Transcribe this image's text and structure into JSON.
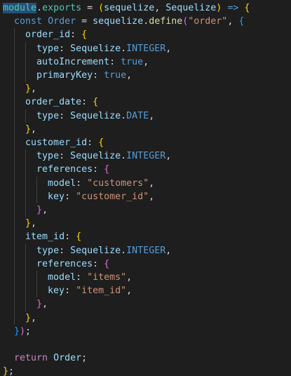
{
  "editor": {
    "theme": {
      "background": "#1e1e1e",
      "default_text": "#d4d4d4",
      "keyword": "#569cd6",
      "control": "#c586c0",
      "variable": "#9cdcfe",
      "type": "#4ec9b0",
      "function": "#dcdcaa",
      "string": "#ce9178",
      "bracket_1": "#ffd700",
      "bracket_2": "#da70d6",
      "bracket_3": "#179fff",
      "indent_guide": "#404040",
      "selection_highlight": "#264f78"
    },
    "lines": [
      {
        "tokens": [
          {
            "t": "module",
            "c": "type",
            "sel": true
          },
          {
            "t": ".",
            "c": "default_text"
          },
          {
            "t": "exports",
            "c": "type"
          },
          {
            "t": " = ",
            "c": "default_text"
          },
          {
            "t": "(",
            "c": "bracket_1"
          },
          {
            "t": "sequelize",
            "c": "variable"
          },
          {
            "t": ", ",
            "c": "default_text"
          },
          {
            "t": "Sequelize",
            "c": "variable"
          },
          {
            "t": ")",
            "c": "bracket_1"
          },
          {
            "t": " ",
            "c": "default_text"
          },
          {
            "t": "=>",
            "c": "keyword"
          },
          {
            "t": " ",
            "c": "default_text"
          },
          {
            "t": "{",
            "c": "bracket_1"
          }
        ]
      },
      {
        "tokens": [
          {
            "t": "  ",
            "c": "default_text"
          },
          {
            "t": "const",
            "c": "keyword"
          },
          {
            "t": " ",
            "c": "default_text"
          },
          {
            "t": "Order",
            "c": "keyword"
          },
          {
            "t": " = ",
            "c": "default_text"
          },
          {
            "t": "sequelize",
            "c": "variable"
          },
          {
            "t": ".",
            "c": "default_text"
          },
          {
            "t": "define",
            "c": "function"
          },
          {
            "t": "(",
            "c": "bracket_2"
          },
          {
            "t": "\"order\"",
            "c": "string"
          },
          {
            "t": ", ",
            "c": "default_text"
          },
          {
            "t": "{",
            "c": "bracket_3"
          }
        ]
      },
      {
        "tokens": [
          {
            "t": "    ",
            "c": "default_text"
          },
          {
            "t": "order_id",
            "c": "variable"
          },
          {
            "t": ": ",
            "c": "default_text"
          },
          {
            "t": "{",
            "c": "bracket_1"
          }
        ]
      },
      {
        "tokens": [
          {
            "t": "      ",
            "c": "default_text"
          },
          {
            "t": "type",
            "c": "variable"
          },
          {
            "t": ": ",
            "c": "default_text"
          },
          {
            "t": "Sequelize",
            "c": "variable"
          },
          {
            "t": ".",
            "c": "default_text"
          },
          {
            "t": "INTEGER",
            "c": "keyword"
          },
          {
            "t": ",",
            "c": "default_text"
          }
        ]
      },
      {
        "tokens": [
          {
            "t": "      ",
            "c": "default_text"
          },
          {
            "t": "autoIncrement",
            "c": "variable"
          },
          {
            "t": ": ",
            "c": "default_text"
          },
          {
            "t": "true",
            "c": "keyword"
          },
          {
            "t": ",",
            "c": "default_text"
          }
        ]
      },
      {
        "tokens": [
          {
            "t": "      ",
            "c": "default_text"
          },
          {
            "t": "primaryKey",
            "c": "variable"
          },
          {
            "t": ": ",
            "c": "default_text"
          },
          {
            "t": "true",
            "c": "keyword"
          },
          {
            "t": ",",
            "c": "default_text"
          }
        ]
      },
      {
        "tokens": [
          {
            "t": "    ",
            "c": "default_text"
          },
          {
            "t": "}",
            "c": "bracket_1"
          },
          {
            "t": ",",
            "c": "default_text"
          }
        ]
      },
      {
        "tokens": [
          {
            "t": "    ",
            "c": "default_text"
          },
          {
            "t": "order_date",
            "c": "variable"
          },
          {
            "t": ": ",
            "c": "default_text"
          },
          {
            "t": "{",
            "c": "bracket_1"
          }
        ]
      },
      {
        "tokens": [
          {
            "t": "      ",
            "c": "default_text"
          },
          {
            "t": "type",
            "c": "variable"
          },
          {
            "t": ": ",
            "c": "default_text"
          },
          {
            "t": "Sequelize",
            "c": "variable"
          },
          {
            "t": ".",
            "c": "default_text"
          },
          {
            "t": "DATE",
            "c": "keyword"
          },
          {
            "t": ",",
            "c": "default_text"
          }
        ]
      },
      {
        "tokens": [
          {
            "t": "    ",
            "c": "default_text"
          },
          {
            "t": "}",
            "c": "bracket_1"
          },
          {
            "t": ",",
            "c": "default_text"
          }
        ]
      },
      {
        "tokens": [
          {
            "t": "    ",
            "c": "default_text"
          },
          {
            "t": "customer_id",
            "c": "variable"
          },
          {
            "t": ": ",
            "c": "default_text"
          },
          {
            "t": "{",
            "c": "bracket_1"
          }
        ]
      },
      {
        "tokens": [
          {
            "t": "      ",
            "c": "default_text"
          },
          {
            "t": "type",
            "c": "variable"
          },
          {
            "t": ": ",
            "c": "default_text"
          },
          {
            "t": "Sequelize",
            "c": "variable"
          },
          {
            "t": ".",
            "c": "default_text"
          },
          {
            "t": "INTEGER",
            "c": "keyword"
          },
          {
            "t": ",",
            "c": "default_text"
          }
        ]
      },
      {
        "tokens": [
          {
            "t": "      ",
            "c": "default_text"
          },
          {
            "t": "references",
            "c": "variable"
          },
          {
            "t": ": ",
            "c": "default_text"
          },
          {
            "t": "{",
            "c": "bracket_2"
          }
        ]
      },
      {
        "tokens": [
          {
            "t": "        ",
            "c": "default_text"
          },
          {
            "t": "model",
            "c": "variable"
          },
          {
            "t": ": ",
            "c": "default_text"
          },
          {
            "t": "\"customers\"",
            "c": "string"
          },
          {
            "t": ",",
            "c": "default_text"
          }
        ]
      },
      {
        "tokens": [
          {
            "t": "        ",
            "c": "default_text"
          },
          {
            "t": "key",
            "c": "variable"
          },
          {
            "t": ": ",
            "c": "default_text"
          },
          {
            "t": "\"customer_id\"",
            "c": "string"
          },
          {
            "t": ",",
            "c": "default_text"
          }
        ]
      },
      {
        "tokens": [
          {
            "t": "      ",
            "c": "default_text"
          },
          {
            "t": "}",
            "c": "bracket_2"
          },
          {
            "t": ",",
            "c": "default_text"
          }
        ]
      },
      {
        "tokens": [
          {
            "t": "    ",
            "c": "default_text"
          },
          {
            "t": "}",
            "c": "bracket_1"
          },
          {
            "t": ",",
            "c": "default_text"
          }
        ]
      },
      {
        "tokens": [
          {
            "t": "    ",
            "c": "default_text"
          },
          {
            "t": "item_id",
            "c": "variable"
          },
          {
            "t": ": ",
            "c": "default_text"
          },
          {
            "t": "{",
            "c": "bracket_1"
          }
        ]
      },
      {
        "tokens": [
          {
            "t": "      ",
            "c": "default_text"
          },
          {
            "t": "type",
            "c": "variable"
          },
          {
            "t": ": ",
            "c": "default_text"
          },
          {
            "t": "Sequelize",
            "c": "variable"
          },
          {
            "t": ".",
            "c": "default_text"
          },
          {
            "t": "INTEGER",
            "c": "keyword"
          },
          {
            "t": ",",
            "c": "default_text"
          }
        ]
      },
      {
        "tokens": [
          {
            "t": "      ",
            "c": "default_text"
          },
          {
            "t": "references",
            "c": "variable"
          },
          {
            "t": ": ",
            "c": "default_text"
          },
          {
            "t": "{",
            "c": "bracket_2"
          }
        ]
      },
      {
        "tokens": [
          {
            "t": "        ",
            "c": "default_text"
          },
          {
            "t": "model",
            "c": "variable"
          },
          {
            "t": ": ",
            "c": "default_text"
          },
          {
            "t": "\"items\"",
            "c": "string"
          },
          {
            "t": ",",
            "c": "default_text"
          }
        ]
      },
      {
        "tokens": [
          {
            "t": "        ",
            "c": "default_text"
          },
          {
            "t": "key",
            "c": "variable"
          },
          {
            "t": ": ",
            "c": "default_text"
          },
          {
            "t": "\"item_id\"",
            "c": "string"
          },
          {
            "t": ",",
            "c": "default_text"
          }
        ]
      },
      {
        "tokens": [
          {
            "t": "      ",
            "c": "default_text"
          },
          {
            "t": "}",
            "c": "bracket_2"
          },
          {
            "t": ",",
            "c": "default_text"
          }
        ]
      },
      {
        "tokens": [
          {
            "t": "    ",
            "c": "default_text"
          },
          {
            "t": "}",
            "c": "bracket_1"
          },
          {
            "t": ",",
            "c": "default_text"
          }
        ]
      },
      {
        "tokens": [
          {
            "t": "  ",
            "c": "default_text"
          },
          {
            "t": "}",
            "c": "bracket_3"
          },
          {
            "t": ")",
            "c": "bracket_2"
          },
          {
            "t": ";",
            "c": "default_text"
          }
        ]
      },
      {
        "tokens": []
      },
      {
        "tokens": [
          {
            "t": "  ",
            "c": "default_text"
          },
          {
            "t": "return",
            "c": "control"
          },
          {
            "t": " ",
            "c": "default_text"
          },
          {
            "t": "Order",
            "c": "variable"
          },
          {
            "t": ";",
            "c": "default_text"
          }
        ]
      },
      {
        "tokens": [
          {
            "t": "}",
            "c": "bracket_1"
          },
          {
            "t": ";",
            "c": "default_text"
          }
        ]
      }
    ]
  }
}
